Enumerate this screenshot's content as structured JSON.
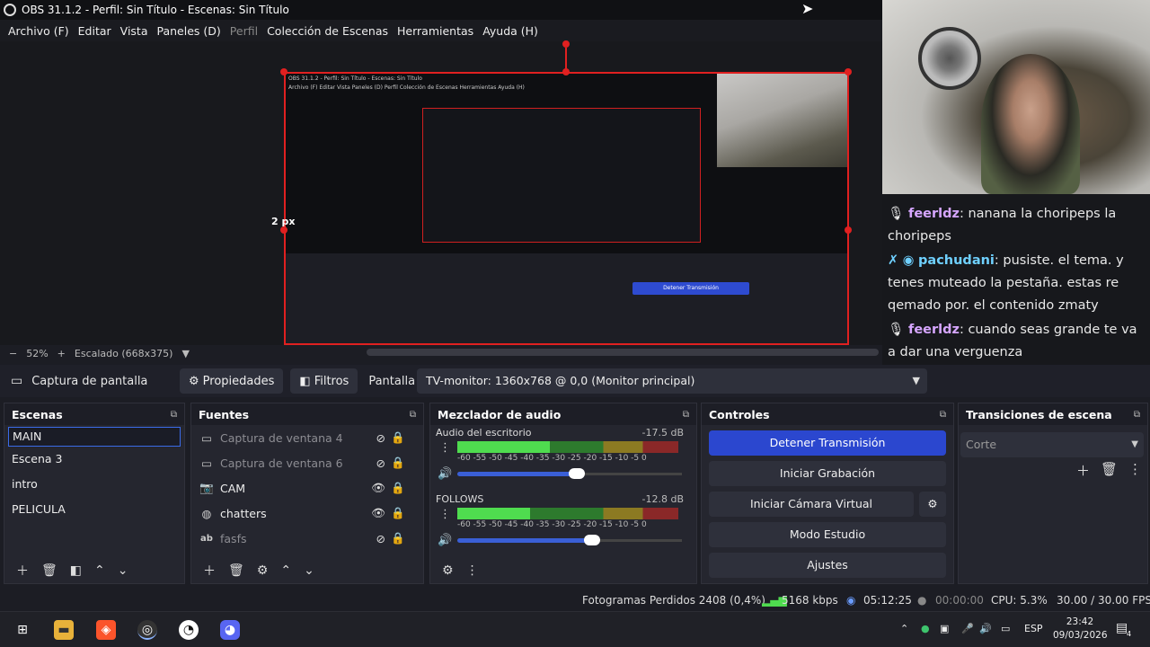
{
  "window": {
    "title": "OBS 31.1.2 - Perfil: Sin Título - Escenas: Sin Título"
  },
  "menu": [
    {
      "label": "Archivo (F)",
      "enabled": true
    },
    {
      "label": "Editar",
      "enabled": true
    },
    {
      "label": "Vista",
      "enabled": true
    },
    {
      "label": "Paneles (D)",
      "enabled": true
    },
    {
      "label": "Perfil",
      "enabled": false
    },
    {
      "label": "Colección de Escenas",
      "enabled": true
    },
    {
      "label": "Herramientas",
      "enabled": true
    },
    {
      "label": "Ayuda (H)",
      "enabled": true
    }
  ],
  "preview": {
    "px_label": "2 px",
    "nested_title": "OBS 31.1.2 - Perfil: Sin Título - Escenas: Sin Título",
    "nested_menu": "Archivo (F)   Editar   Vista   Paneles (D)   Perfil   Colección de Escenas   Herramientas   Ayuda (H)",
    "nested_control": "Detener Transmisión",
    "zoom": "52%",
    "scale": "Escalado (668x375)"
  },
  "chat": [
    {
      "user": "feerldz",
      "text": "nanana la choripeps la choripeps",
      "color": "#d6a6ff"
    },
    {
      "user": "pachudani",
      "text": "pusiste. el tema. y tenes muteado la pestaña. estas re qemado por. el contenido zmaty",
      "color": "#6fd0ff"
    },
    {
      "user": "feerldz",
      "text": "cuando seas grande te va a dar una verguenza",
      "color": "#d6a6ff"
    }
  ],
  "source_bar": {
    "source": "Captura de pantalla",
    "properties": "Propiedades",
    "filters": "Filtros",
    "display_label": "Pantalla",
    "display_value": "TV-monitor: 1360x768 @ 0,0 (Monitor principal)"
  },
  "scenes": {
    "title": "Escenas",
    "items": [
      "MAIN",
      "Escena 3",
      "intro",
      "PELICULA"
    ],
    "selected": 0
  },
  "sources": {
    "title": "Fuentes",
    "items": [
      {
        "label": "Captura de ventana 4",
        "icon": "window-icon",
        "visible": false
      },
      {
        "label": "Captura de ventana 6",
        "icon": "window-icon",
        "visible": false
      },
      {
        "label": "CAM",
        "icon": "camera-icon",
        "visible": true
      },
      {
        "label": "chatters",
        "icon": "browser-icon",
        "visible": true
      },
      {
        "label": "fasfs",
        "icon": "text-icon",
        "visible": false
      }
    ]
  },
  "mixer": {
    "title": "Mezclador de audio",
    "channels": [
      {
        "name": "Audio del escritorio",
        "db": "-17.5 dB",
        "level": 0.42,
        "volume": 0.55
      },
      {
        "name": "FOLLOWS",
        "db": "-12.8 dB",
        "level": 0.33,
        "volume": 0.62
      }
    ],
    "ticks": "-60 -55 -50 -45 -40 -35 -30 -25 -20 -15 -10 -5 0"
  },
  "controls": {
    "title": "Controles",
    "stop_stream": "Detener Transmisión",
    "start_recording": "Iniciar Grabación",
    "virtual_cam": "Iniciar Cámara Virtual",
    "studio_mode": "Modo Estudio",
    "settings": "Ajustes"
  },
  "transitions": {
    "title": "Transiciones de escena",
    "selected": "Corte"
  },
  "status": {
    "dropped": "Fotogramas Perdidos 2408 (0,4%)",
    "bitrate": "5168 kbps",
    "live_time": "05:12:25",
    "rec_time": "00:00:00",
    "cpu": "CPU: 5.3%",
    "fps": "30.00 / 30.00 FPS"
  },
  "taskbar": {
    "lang": "ESP",
    "time": "23:42",
    "date": "09/03/2026",
    "notifications": "4"
  }
}
